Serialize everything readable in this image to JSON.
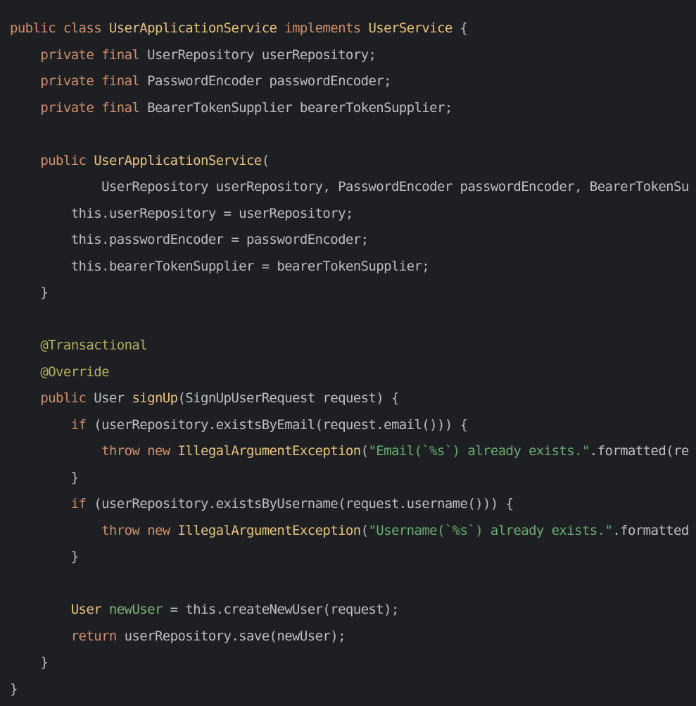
{
  "editor": {
    "background": "#1e1f22",
    "colors": {
      "keyword": "#cf8e6d",
      "type": "#e8c27f",
      "annotation": "#b3ae60",
      "string": "#6aab73",
      "variable": "#7fb37a",
      "plain": "#bcbec4"
    },
    "lines": [
      [
        {
          "t": "public class ",
          "c": "kw"
        },
        {
          "t": "UserApplicationService",
          "c": "type"
        },
        {
          "t": " implements ",
          "c": "kw"
        },
        {
          "t": "UserService",
          "c": "type"
        },
        {
          "t": " {",
          "c": "plain"
        }
      ],
      [
        {
          "t": "    private final ",
          "c": "kw"
        },
        {
          "t": "UserRepository userRepository;",
          "c": "plain"
        }
      ],
      [
        {
          "t": "    private final ",
          "c": "kw"
        },
        {
          "t": "PasswordEncoder passwordEncoder;",
          "c": "plain"
        }
      ],
      [
        {
          "t": "    private final ",
          "c": "kw"
        },
        {
          "t": "BearerTokenSupplier bearerTokenSupplier;",
          "c": "plain"
        }
      ],
      [],
      [
        {
          "t": "    public ",
          "c": "kw"
        },
        {
          "t": "UserApplicationService",
          "c": "fn"
        },
        {
          "t": "(",
          "c": "plain"
        }
      ],
      [
        {
          "t": "            UserRepository userRepository, PasswordEncoder passwordEncoder, BearerTokenSu",
          "c": "plain"
        }
      ],
      [
        {
          "t": "        this.userRepository = userRepository;",
          "c": "plain"
        }
      ],
      [
        {
          "t": "        this.passwordEncoder = passwordEncoder;",
          "c": "plain"
        }
      ],
      [
        {
          "t": "        this.bearerTokenSupplier = bearerTokenSupplier;",
          "c": "plain"
        }
      ],
      [
        {
          "t": "    }",
          "c": "plain"
        }
      ],
      [],
      [
        {
          "t": "    @Transactional",
          "c": "ann"
        }
      ],
      [
        {
          "t": "    @Override",
          "c": "ann"
        }
      ],
      [
        {
          "t": "    public ",
          "c": "kw"
        },
        {
          "t": "User ",
          "c": "plain"
        },
        {
          "t": "signUp",
          "c": "fn"
        },
        {
          "t": "(SignUpUserRequest request) {",
          "c": "plain"
        }
      ],
      [
        {
          "t": "        if ",
          "c": "kw"
        },
        {
          "t": "(userRepository.existsByEmail(request.email())) {",
          "c": "plain"
        }
      ],
      [
        {
          "t": "            throw new ",
          "c": "kw"
        },
        {
          "t": "IllegalArgumentException",
          "c": "fn"
        },
        {
          "t": "(",
          "c": "plain"
        },
        {
          "t": "\"Email(`%s`) already exists.\"",
          "c": "str"
        },
        {
          "t": ".formatted(re",
          "c": "plain"
        }
      ],
      [
        {
          "t": "        }",
          "c": "plain"
        }
      ],
      [
        {
          "t": "        if ",
          "c": "kw"
        },
        {
          "t": "(userRepository.existsByUsername(request.username())) {",
          "c": "plain"
        }
      ],
      [
        {
          "t": "            throw new ",
          "c": "kw"
        },
        {
          "t": "IllegalArgumentException",
          "c": "fn"
        },
        {
          "t": "(",
          "c": "plain"
        },
        {
          "t": "\"Username(`%s`) already exists.\"",
          "c": "str"
        },
        {
          "t": ".formatted",
          "c": "plain"
        }
      ],
      [
        {
          "t": "        }",
          "c": "plain"
        }
      ],
      [],
      [
        {
          "t": "        User ",
          "c": "type"
        },
        {
          "t": "newUser",
          "c": "var"
        },
        {
          "t": " = this.createNewUser(request);",
          "c": "plain"
        }
      ],
      [
        {
          "t": "        return ",
          "c": "kw"
        },
        {
          "t": "userRepository.save(newUser);",
          "c": "plain"
        }
      ],
      [
        {
          "t": "    }",
          "c": "plain"
        }
      ],
      [
        {
          "t": "}",
          "c": "plain"
        }
      ]
    ]
  }
}
